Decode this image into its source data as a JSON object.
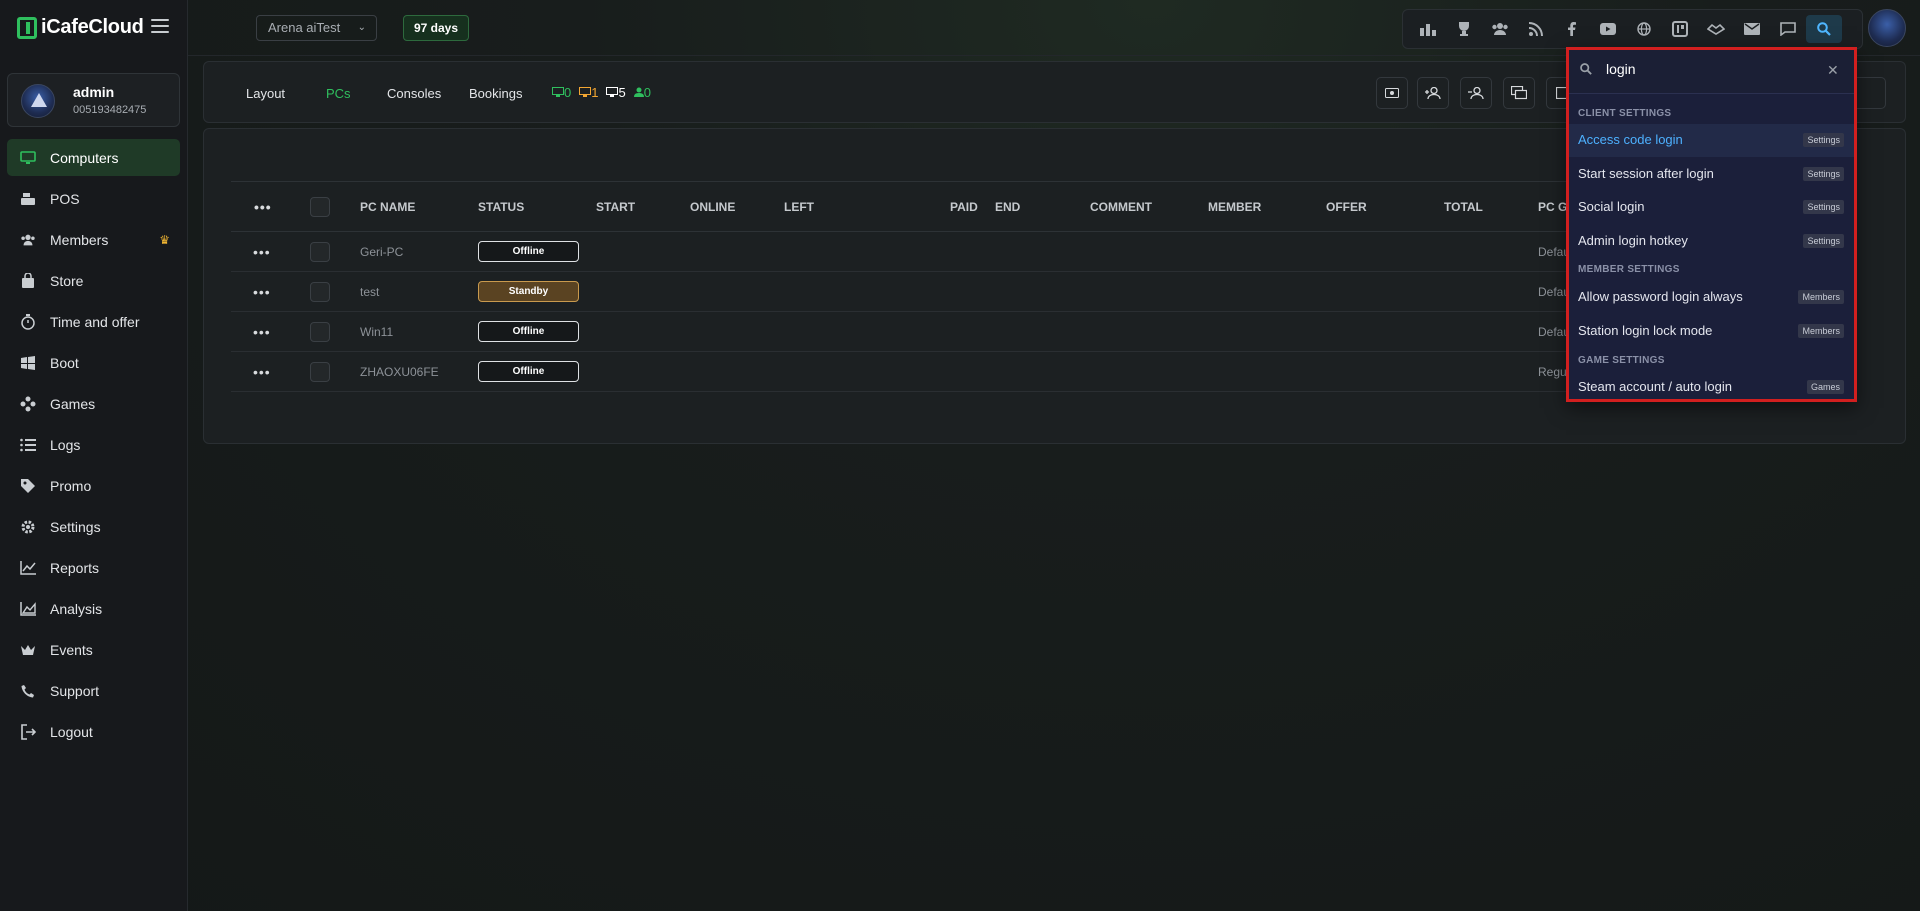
{
  "app": {
    "logo": "iCafeCloud"
  },
  "profile": {
    "name": "admin",
    "id": "005193482475"
  },
  "sidebar": {
    "items": [
      {
        "label": "Computers",
        "icon": "monitor-icon"
      },
      {
        "label": "POS",
        "icon": "cash-register-icon"
      },
      {
        "label": "Members",
        "icon": "users-icon",
        "badge": "♛"
      },
      {
        "label": "Store",
        "icon": "shopping-bag-icon"
      },
      {
        "label": "Time and offer",
        "icon": "stopwatch-icon"
      },
      {
        "label": "Boot",
        "icon": "windows-icon"
      },
      {
        "label": "Games",
        "icon": "gamepad-icon"
      },
      {
        "label": "Logs",
        "icon": "list-icon"
      },
      {
        "label": "Promo",
        "icon": "tag-icon"
      },
      {
        "label": "Settings",
        "icon": "gear-icon"
      },
      {
        "label": "Reports",
        "icon": "line-chart-icon"
      },
      {
        "label": "Analysis",
        "icon": "area-chart-icon"
      },
      {
        "label": "Events",
        "icon": "crown-icon"
      },
      {
        "label": "Support",
        "icon": "phone-icon"
      },
      {
        "label": "Logout",
        "icon": "logout-icon"
      }
    ]
  },
  "header": {
    "branch": "Arena aiTest",
    "days": "97 days"
  },
  "tabs": {
    "layout": "Layout",
    "pcs": "PCs",
    "consoles": "Consoles",
    "bookings": "Bookings",
    "counts": {
      "online": "0",
      "busy": "1",
      "total": "5",
      "members": "0"
    }
  },
  "table": {
    "headers": [
      "PC NAME",
      "STATUS",
      "START",
      "ONLINE",
      "LEFT",
      "PAID",
      "END",
      "COMMENT",
      "MEMBER",
      "OFFER",
      "TOTAL",
      "PC GR"
    ],
    "rows": [
      {
        "name": "Geri-PC",
        "status": "Offline",
        "group": "Defau"
      },
      {
        "name": "test",
        "status": "Standby",
        "group": "Defau"
      },
      {
        "name": "Win11",
        "status": "Offline",
        "group": "Defau"
      },
      {
        "name": "ZHAOXU06FE",
        "status": "Offline",
        "group": "Regul"
      }
    ]
  },
  "search": {
    "query": "login",
    "sections": [
      {
        "title": "CLIENT SETTINGS",
        "results": [
          {
            "label": "Access code login",
            "tag": "Settings"
          },
          {
            "label": "Start session after login",
            "tag": "Settings"
          },
          {
            "label": "Social login",
            "tag": "Settings"
          },
          {
            "label": "Admin login hotkey",
            "tag": "Settings"
          }
        ]
      },
      {
        "title": "MEMBER SETTINGS",
        "results": [
          {
            "label": "Allow password login always",
            "tag": "Members"
          },
          {
            "label": "Station login lock mode",
            "tag": "Members"
          }
        ]
      },
      {
        "title": "GAME SETTINGS",
        "results": [
          {
            "label": "Steam account / auto login",
            "tag": "Games"
          }
        ]
      }
    ]
  }
}
